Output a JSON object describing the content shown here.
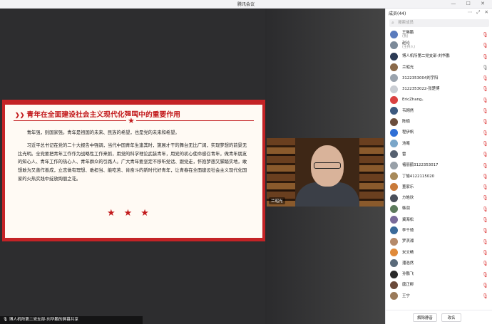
{
  "window": {
    "title": "腾讯会议",
    "controls": "— ☐ ✕"
  },
  "slide": {
    "title": "青年在全面建设社会主义现代化强国中的重要作用",
    "paragraphs": [
      "青年强，则国家强。青年是祖国的未来、民族的希望，也是党的未来和希望。",
      "习近平总书记在党的二十大报告中强调，当代中国青年生逢其时，施展才干的舞台无比广阔，实现梦想的前景无比光明。全党要把青年工作作为战略性工作来抓，用党的科学理论武装青年，用党的初心使命感召青年，做青年朋友的知心人、青年工作的热心人、青年群众的引路人。广大青年要坚定不移听党话、跟党走，怀抱梦想又脚踏实地，敢想敢为又善作善成，立志做有理想、敢担当、能吃苦、肯奋斗的新时代好青年，让青春在全面建设社会主义现代化国家的火热实践中绽放绚丽之花。"
    ],
    "stars": "★★★"
  },
  "video": {
    "name": "兰昭光"
  },
  "share_bar": "博人机所第二党支部-刘华鹏的屏幕共享",
  "panel": {
    "title": "成员(44)",
    "controls": "⋯ ⤢ ✕",
    "search_placeholder": "搜索成员",
    "members": [
      {
        "name": "王琳鹏",
        "sub": "(我)",
        "color": "#5a7bbd",
        "mic": "🎙"
      },
      {
        "name": "赵论",
        "sub": "(主持人)",
        "color": "#7c8a99",
        "mic": "🎙"
      },
      {
        "name": "博人机所第二党支部-刘华鹏",
        "sub": "",
        "color": "#2b3a55",
        "mic": "🎙"
      },
      {
        "name": "兰昭光",
        "sub": "",
        "color": "#8a6a4a",
        "mic": "🎙"
      },
      {
        "name": "3122353004刘宇阳",
        "sub": "",
        "color": "#9aa3ad",
        "mic": "🎙"
      },
      {
        "name": "3122353022-张楚博",
        "sub": "",
        "color": "#c9cdd3",
        "mic": "🎙"
      },
      {
        "name": "EricZhang。",
        "sub": "",
        "color": "#d94141",
        "mic": "🎙"
      },
      {
        "name": "韦翱然",
        "sub": "",
        "color": "#3d5a80",
        "mic": "🎙"
      },
      {
        "name": "陈楠",
        "sub": "",
        "color": "#6b4e3d",
        "mic": "🎙"
      },
      {
        "name": "程伊帆",
        "sub": "",
        "color": "#2f6fd6",
        "mic": "🎙"
      },
      {
        "name": "池庵",
        "sub": "",
        "color": "#7aa6c9",
        "mic": "🎙"
      },
      {
        "name": "雷",
        "sub": "",
        "color": "#556070",
        "mic": "🎙"
      },
      {
        "name": "褚丽鹤3122353017",
        "sub": "",
        "color": "#98a0a8",
        "mic": "🎙"
      },
      {
        "name": "丁愉4122115020",
        "sub": "",
        "color": "#a88a5a",
        "mic": "🎙"
      },
      {
        "name": "董家乐",
        "sub": "",
        "color": "#c97a3a",
        "mic": "🎙"
      },
      {
        "name": "方皓欣",
        "sub": "",
        "color": "#4a4f5a",
        "mic": "🎙"
      },
      {
        "name": "韩润",
        "sub": "",
        "color": "#5c7a5c",
        "mic": "🎙"
      },
      {
        "name": "冀海松",
        "sub": "",
        "color": "#7a6b9a",
        "mic": "🎙"
      },
      {
        "name": "李千琦",
        "sub": "",
        "color": "#3a6a9a",
        "mic": "🎙"
      },
      {
        "name": "罗淇湘",
        "sub": "",
        "color": "#b58a6a",
        "mic": "🎙"
      },
      {
        "name": "米文畅",
        "sub": "",
        "color": "#e08a3a",
        "mic": "🎙"
      },
      {
        "name": "潘浩然",
        "sub": "",
        "color": "#5a6a7a",
        "mic": "🎙"
      },
      {
        "name": "孙鹏飞",
        "sub": "",
        "color": "#2a2a2a",
        "mic": "🎙"
      },
      {
        "name": "唐正柳",
        "sub": "",
        "color": "#6a4a3a",
        "mic": "🎙"
      },
      {
        "name": "王宁",
        "sub": "",
        "color": "#9a7a5a",
        "mic": "🎙"
      }
    ],
    "mute_all": "解除静音",
    "invite": "改名"
  }
}
